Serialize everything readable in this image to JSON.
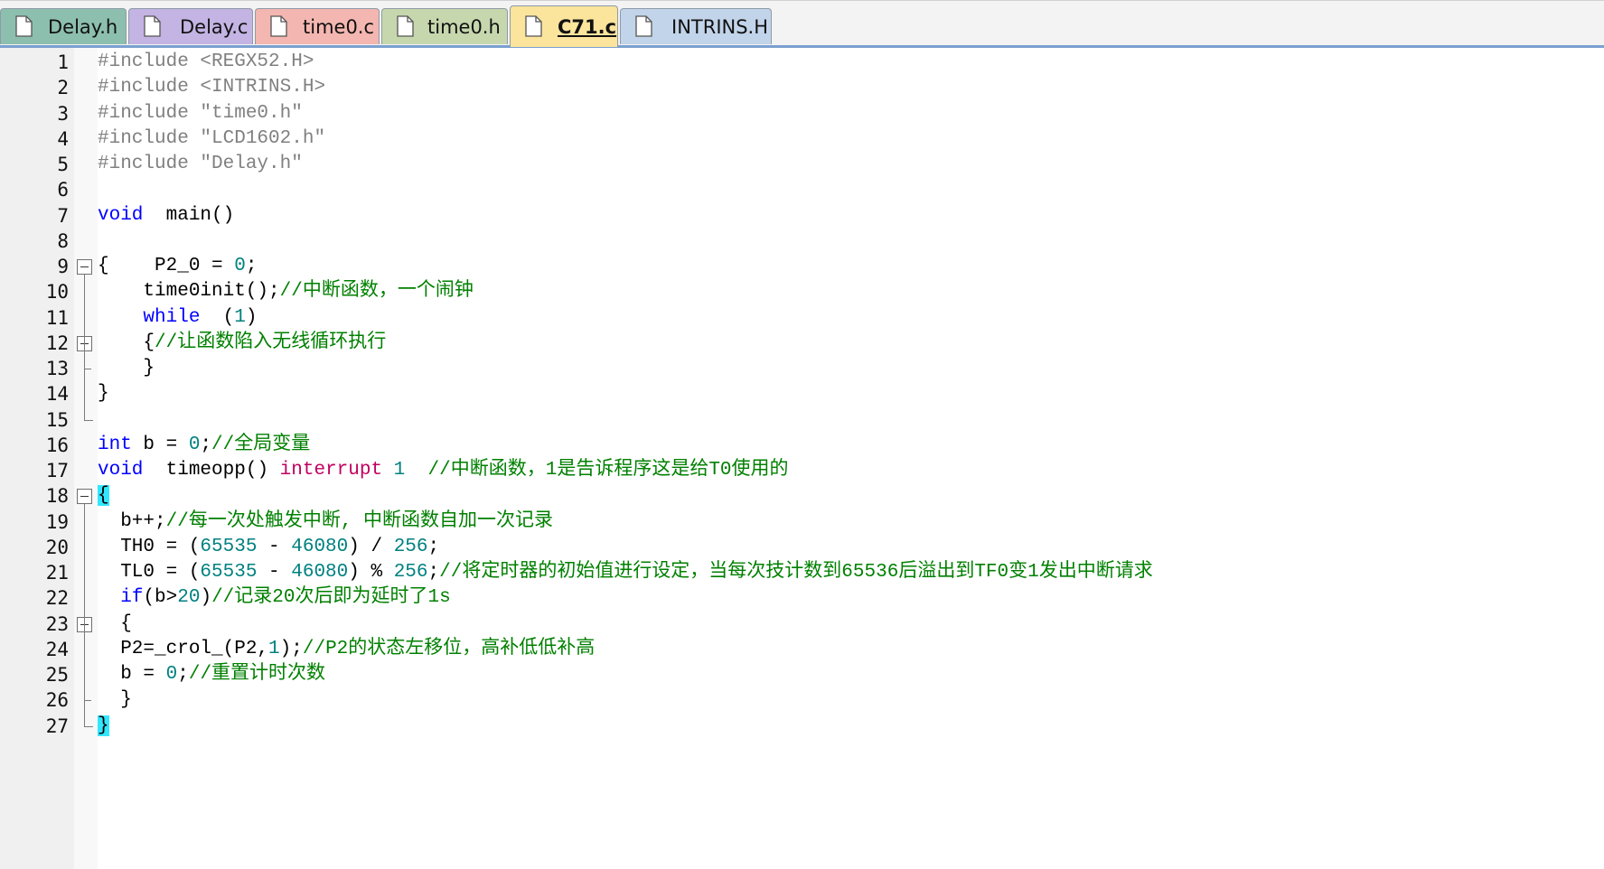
{
  "tabs": [
    {
      "label": "Delay.h",
      "color": "#8dbfae",
      "active": false
    },
    {
      "label": "Delay.c",
      "color": "#c3b4e3",
      "active": false
    },
    {
      "label": "time0.c",
      "color": "#f4b6b0",
      "active": false
    },
    {
      "label": "time0.h",
      "color": "#c6d7ae",
      "active": false
    },
    {
      "label": "C71.c",
      "color": "#fbe49c",
      "active": true
    },
    {
      "label": "INTRINS.H",
      "color": "#c2d4ea",
      "active": false
    }
  ],
  "editor": {
    "lines": [
      {
        "n": "1",
        "tokens": [
          [
            "pp",
            "#include "
          ],
          [
            "str",
            "<REGX52.H>"
          ]
        ]
      },
      {
        "n": "2",
        "tokens": [
          [
            "pp",
            "#include "
          ],
          [
            "str",
            "<INTRINS.H>"
          ]
        ]
      },
      {
        "n": "3",
        "tokens": [
          [
            "pp",
            "#include "
          ],
          [
            "str",
            "\"time0.h\""
          ]
        ]
      },
      {
        "n": "4",
        "tokens": [
          [
            "pp",
            "#include "
          ],
          [
            "str",
            "\"LCD1602.h\""
          ]
        ]
      },
      {
        "n": "5",
        "tokens": [
          [
            "pp",
            "#include "
          ],
          [
            "str",
            "\"Delay.h\""
          ]
        ]
      },
      {
        "n": "6",
        "tokens": []
      },
      {
        "n": "7",
        "tokens": [
          [
            "kw",
            "void"
          ],
          [
            "",
            "  main()"
          ]
        ]
      },
      {
        "n": "8",
        "tokens": []
      },
      {
        "n": "9",
        "tokens": [
          [
            "",
            "{    P2_0 = "
          ],
          [
            "num",
            "0"
          ],
          [
            "",
            ";"
          ]
        ]
      },
      {
        "n": "10",
        "tokens": [
          [
            "",
            "    time0init();"
          ],
          [
            "cm",
            "//中断函数，一个闹钟"
          ]
        ]
      },
      {
        "n": "11",
        "tokens": [
          [
            "",
            "    "
          ],
          [
            "kw",
            "while"
          ],
          [
            "",
            "  ("
          ],
          [
            "num",
            "1"
          ],
          [
            "",
            ")"
          ]
        ]
      },
      {
        "n": "12",
        "tokens": [
          [
            "",
            "    {"
          ],
          [
            "cm",
            "//让函数陷入无线循环执行"
          ]
        ]
      },
      {
        "n": "13",
        "tokens": [
          [
            "",
            "    }"
          ]
        ]
      },
      {
        "n": "14",
        "tokens": [
          [
            "",
            "}"
          ]
        ]
      },
      {
        "n": "15",
        "tokens": []
      },
      {
        "n": "16",
        "tokens": [
          [
            "kw",
            "int"
          ],
          [
            "",
            " b = "
          ],
          [
            "num",
            "0"
          ],
          [
            "",
            ";"
          ],
          [
            "cm",
            "//全局变量"
          ]
        ]
      },
      {
        "n": "17",
        "tokens": [
          [
            "kw",
            "void"
          ],
          [
            "",
            "  timeopp() "
          ],
          [
            "kw2",
            "interrupt"
          ],
          [
            "num",
            " 1"
          ],
          [
            "",
            "  "
          ],
          [
            "cm",
            "//中断函数，1是告诉程序这是给T0使用的"
          ]
        ]
      },
      {
        "n": "18",
        "tokens": [
          [
            "bhl",
            "{"
          ]
        ]
      },
      {
        "n": "19",
        "tokens": [
          [
            "",
            "  b++;"
          ],
          [
            "cm",
            "//每一次处触发中断, 中断函数自加一次记录"
          ]
        ]
      },
      {
        "n": "20",
        "tokens": [
          [
            "",
            "  TH0 = ("
          ],
          [
            "num",
            "65535"
          ],
          [
            "",
            " - "
          ],
          [
            "num",
            "46080"
          ],
          [
            "",
            ") / "
          ],
          [
            "num",
            "256"
          ],
          [
            "",
            ";"
          ]
        ]
      },
      {
        "n": "21",
        "tokens": [
          [
            "",
            "  TL0 = ("
          ],
          [
            "num",
            "65535"
          ],
          [
            "",
            " - "
          ],
          [
            "num",
            "46080"
          ],
          [
            "",
            ") % "
          ],
          [
            "num",
            "256"
          ],
          [
            "",
            ";"
          ],
          [
            "cm",
            "//将定时器的初始值进行设定，当每次技计数到65536后溢出到TF0变1发出中断请求"
          ]
        ]
      },
      {
        "n": "22",
        "tokens": [
          [
            "",
            "  "
          ],
          [
            "kw",
            "if"
          ],
          [
            "",
            "(b>"
          ],
          [
            "num",
            "20"
          ],
          [
            "",
            ")"
          ],
          [
            "cm",
            "//记录20次后即为延时了1s"
          ]
        ]
      },
      {
        "n": "23",
        "tokens": [
          [
            "",
            "  {"
          ]
        ]
      },
      {
        "n": "24",
        "tokens": [
          [
            "",
            "  P2=_crol_(P2,"
          ],
          [
            "num",
            "1"
          ],
          [
            "",
            ");"
          ],
          [
            "cm",
            "//P2的状态左移位，高补低低补高"
          ]
        ]
      },
      {
        "n": "25",
        "tokens": [
          [
            "",
            "  b = "
          ],
          [
            "num",
            "0"
          ],
          [
            "",
            ";"
          ],
          [
            "cm",
            "//重置计时次数"
          ]
        ]
      },
      {
        "n": "26",
        "tokens": [
          [
            "",
            "  }"
          ]
        ]
      },
      {
        "n": "27",
        "tokens": [
          [
            "bhl",
            "}"
          ]
        ]
      }
    ]
  },
  "colors": {
    "keyword": "#0000ff",
    "keyword2": "#c00060",
    "preprocessor": "#808080",
    "number": "#008080",
    "comment": "#008000",
    "brace_highlight": "#33e6ff"
  }
}
